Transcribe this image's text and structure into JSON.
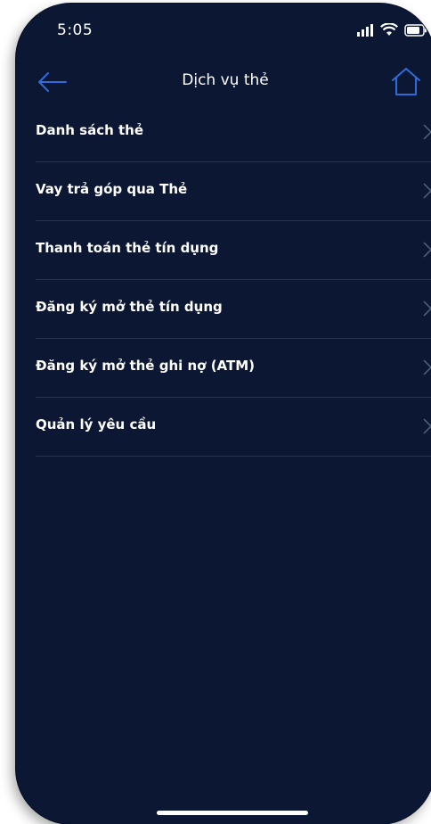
{
  "status_bar": {
    "time": "5:05"
  },
  "header": {
    "title": "Dịch vụ thẻ"
  },
  "menu": {
    "items": [
      {
        "label": "Danh sách thẻ"
      },
      {
        "label": "Vay trả góp qua Thẻ"
      },
      {
        "label": "Thanh toán thẻ tín dụng"
      },
      {
        "label": "Đăng ký mở thẻ tín dụng"
      },
      {
        "label": "Đăng ký mở thẻ ghi nợ (ATM)"
      },
      {
        "label": "Quản lý yêu cầu"
      }
    ]
  },
  "colors": {
    "background": "#0b1733",
    "accent": "#2f6bd9",
    "divider": "#1f3563",
    "text": "#ffffff"
  },
  "icons": {
    "back": "arrow-left-icon",
    "home": "home-icon",
    "chevron": "chevron-right-icon",
    "signal": "signal-icon",
    "wifi": "wifi-icon",
    "battery": "battery-icon"
  }
}
